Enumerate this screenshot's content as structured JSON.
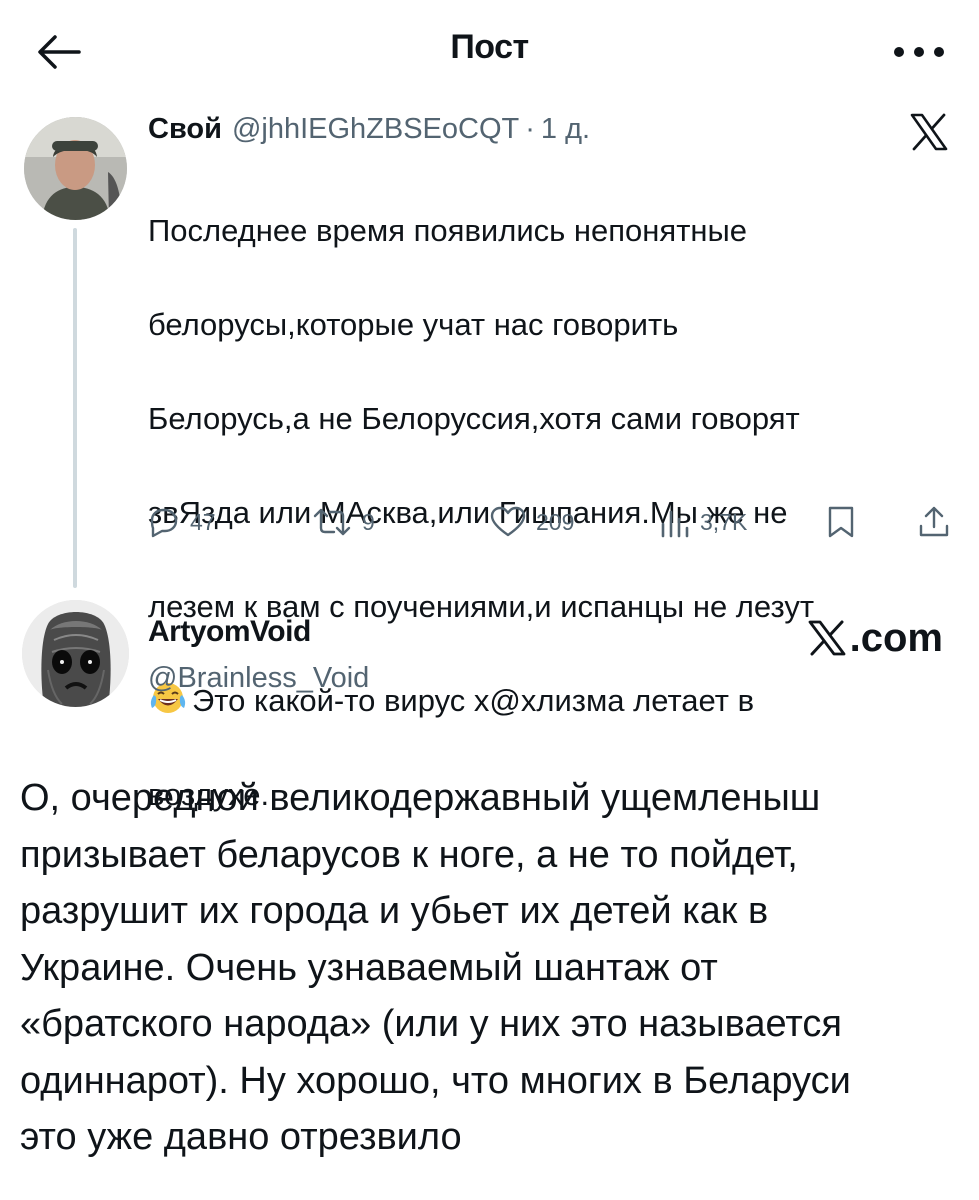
{
  "header": {
    "title": "Пост",
    "back_icon": "arrow-left-icon",
    "more_icon": "more-dots-icon"
  },
  "quoted_tweet": {
    "author_name": "Свой",
    "author_handle": "@jhhIEGhZBSEoCQT",
    "separator": "·",
    "time": "1 д.",
    "platform_icon": "x-logo-icon",
    "text_lines": [
      "Последнее время появились непонятные",
      "белорусы,которые учат нас говорить",
      "Белорусь,а не Белоруссия,хотя сами говорят",
      "звЯзда или МАсква,или Гишпания.Мы же не",
      "лезем к вам с поучениями,и испанцы не лезут",
      "Это какой-то вирус х@хлизма летает в",
      "воздухе."
    ],
    "emoji": "laughing-crying-emoji",
    "actions": {
      "replies": "47",
      "reposts": "9",
      "likes": "209",
      "views": "3,7K"
    }
  },
  "main_tweet": {
    "author_name": "ArtyomVoid",
    "author_handle": "@Brainless_Void",
    "source_label": ".com",
    "text": "О, очередной великодержавный ущемленыш\nпризывает беларусов к ноге, а не то пойдет,\nразрушит их города и убьет их детей как в\nУкраине. Очень узнаваемый шантаж от\n«братского народа» (или у них это называется\nодиннарот). Ну хорошо, что многих в Беларуси\nэто уже давно отрезвило"
  },
  "colors": {
    "text": "#0f1419",
    "secondary": "#536471",
    "thread_line": "#cfd9de"
  }
}
